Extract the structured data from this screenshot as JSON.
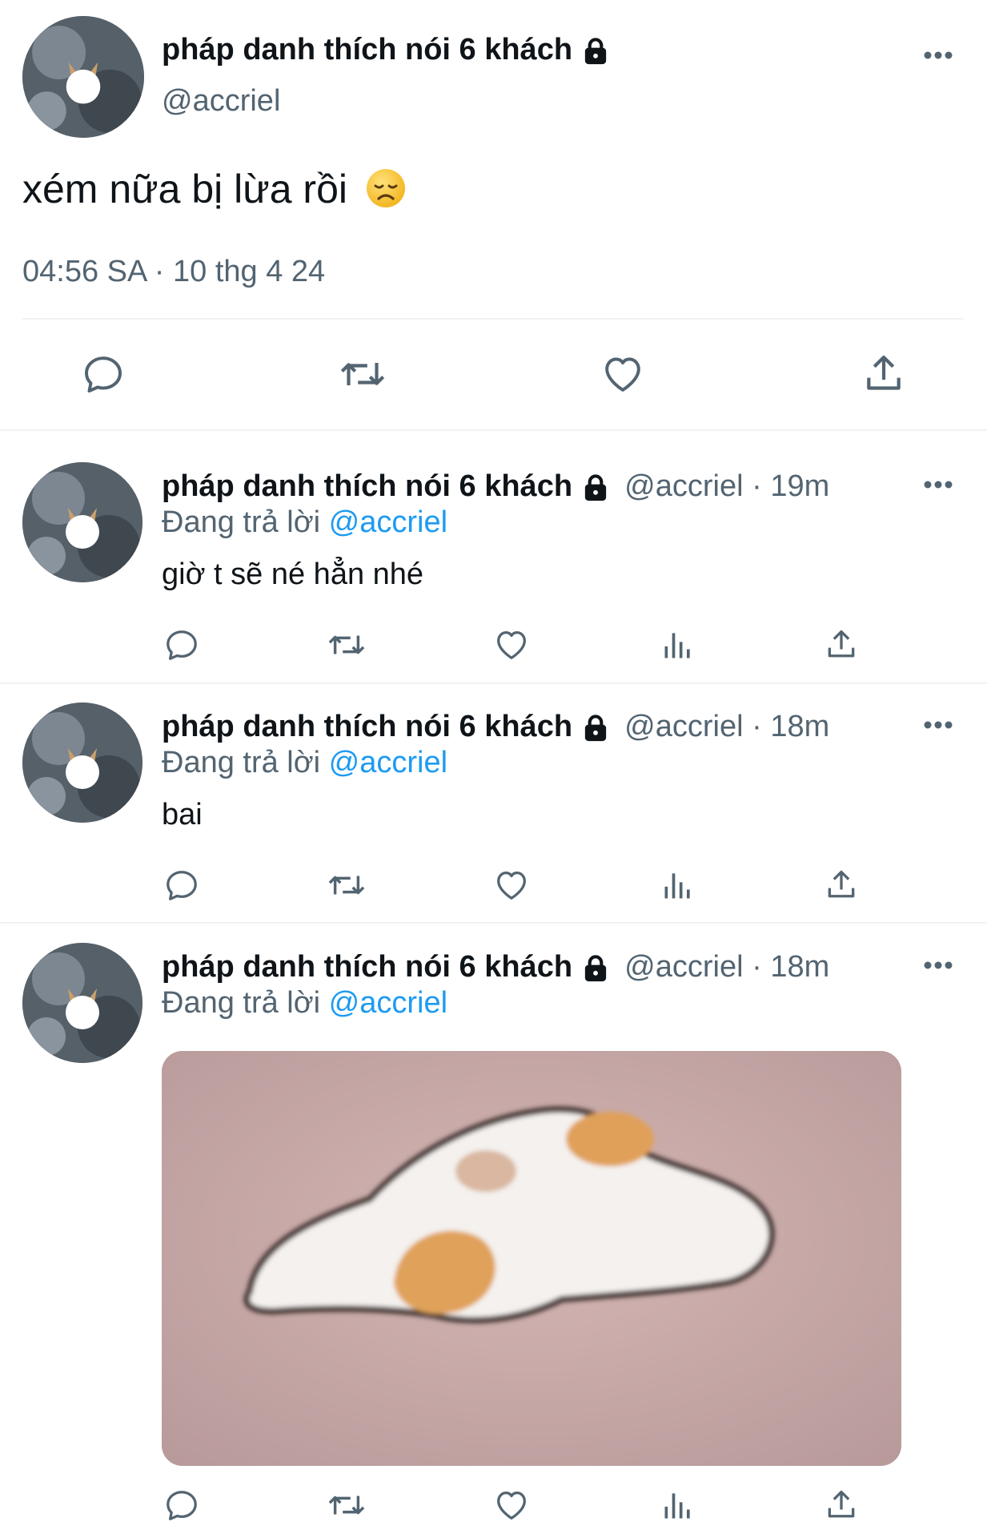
{
  "main_tweet": {
    "author_name": "pháp danh thích nói 6 khách",
    "handle": "@accriel",
    "text": "xém nữa bị lừa rồi",
    "emoji": "😞",
    "timestamp": "04:56 SA · 10 thg 4 24"
  },
  "replies": [
    {
      "author_name": "pháp danh thích nói 6 khách",
      "handle_time": "@accriel · 19m",
      "replying_prefix": "Đang trả lời",
      "replying_to": "@accriel",
      "text": "giờ t sẽ né hẳn nhé"
    },
    {
      "author_name": "pháp danh thích nói 6 khách",
      "handle_time": "@accriel · 18m",
      "replying_prefix": "Đang trả lời",
      "replying_to": "@accriel",
      "text": "bai"
    },
    {
      "author_name": "pháp danh thích nói 6 khách",
      "handle_time": "@accriel · 18m",
      "replying_prefix": "Đang trả lời",
      "replying_to": "@accriel",
      "media": "cat-loaf-image"
    }
  ],
  "icons": [
    "more-icon",
    "lock-icon",
    "reply-icon",
    "retweet-icon",
    "like-icon",
    "views-icon",
    "share-icon"
  ],
  "colors": {
    "link": "#1d9bf0",
    "secondary_text": "#536471",
    "icon": "#536471",
    "divider": "#eff3f4"
  }
}
